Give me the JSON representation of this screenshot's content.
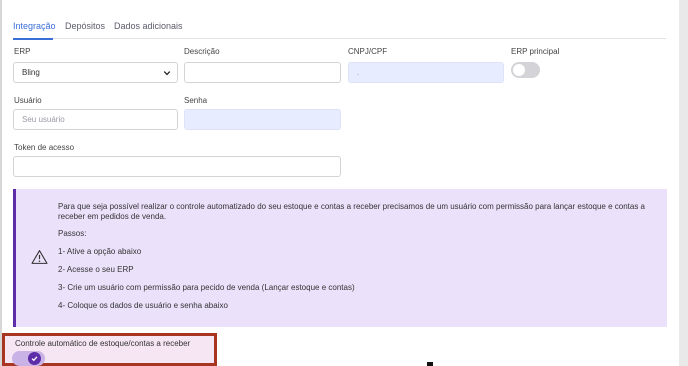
{
  "tabs": [
    {
      "label": "Integração",
      "active": true
    },
    {
      "label": "Depósitos",
      "active": false
    },
    {
      "label": "Dados adicionais",
      "active": false
    }
  ],
  "form": {
    "erp": {
      "label": "ERP",
      "value": "Bling"
    },
    "descricao": {
      "label": "Descrição",
      "value": ""
    },
    "cnpj": {
      "label": "CNPJ/CPF",
      "value": "."
    },
    "erp_principal": {
      "label": "ERP principal",
      "on": false
    },
    "usuario": {
      "label": "Usuário",
      "placeholder": "Seu usuário"
    },
    "senha": {
      "label": "Senha",
      "value": ""
    },
    "token": {
      "label": "Token de acesso",
      "value": ""
    }
  },
  "alert": {
    "intro_line1": "Para que seja possível realizar o controle automatizado do seu estoque e contas a receber precisamos de um usuário com permissão para lançar estoque e contas a",
    "intro_line2": "receber em pedidos de venda.",
    "steps_title": "Passos:",
    "steps": [
      "1- Ative a opção abaixo",
      "2- Acesse o seu ERP",
      "3- Crie um usuário com permissão para pecido de venda (Lançar estoque e contas)",
      "4- Coloque os dados de usuário e senha abaixo"
    ]
  },
  "auto_control": {
    "label": "Controle automático de estoque/contas a receber",
    "on": true
  },
  "colors": {
    "accent_blue": "#3a6fd8",
    "purple": "#5d2ca8",
    "alert_bg": "#ece1fb",
    "highlight_border": "#a83422",
    "disabled_field": "#e8ecff"
  }
}
